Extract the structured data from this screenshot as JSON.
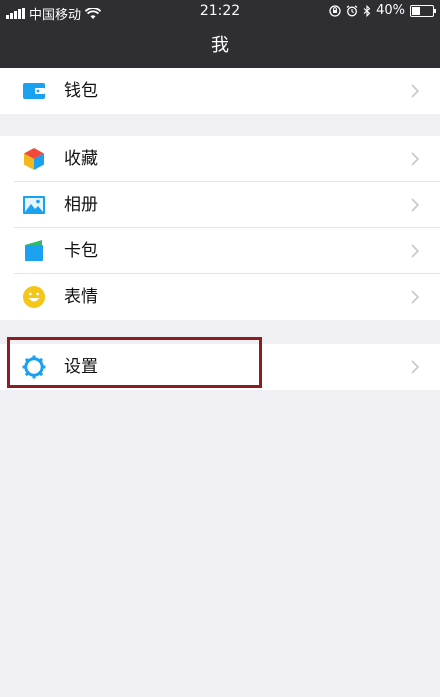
{
  "status": {
    "carrier": "中国移动",
    "time": "21:22",
    "battery_text": "40%",
    "battery_level": 0.4
  },
  "nav": {
    "title": "我"
  },
  "groups": [
    {
      "items": [
        {
          "label": "钱包",
          "icon": "wallet-icon"
        }
      ]
    },
    {
      "items": [
        {
          "label": "收藏",
          "icon": "favorites-cube-icon"
        },
        {
          "label": "相册",
          "icon": "photo-album-icon"
        },
        {
          "label": "卡包",
          "icon": "card-pack-icon"
        },
        {
          "label": "表情",
          "icon": "emoji-smiley-icon"
        }
      ]
    },
    {
      "items": [
        {
          "label": "设置",
          "icon": "settings-gear-icon"
        }
      ]
    }
  ],
  "colors": {
    "bar": "#2f2f33",
    "background": "#efeff4",
    "highlight": "#8b1f1f",
    "icon_blue": "#1aa1f0"
  }
}
